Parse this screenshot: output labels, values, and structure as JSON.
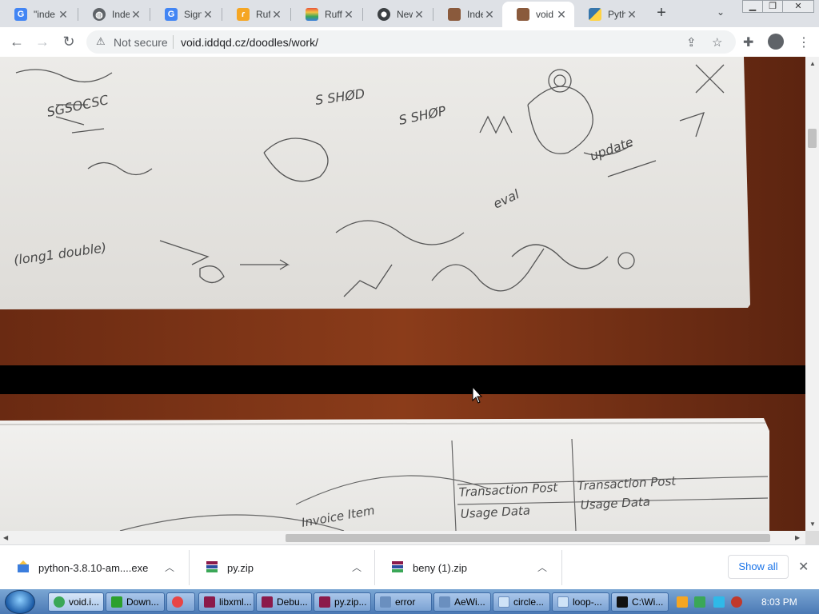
{
  "tabs": [
    {
      "title": "\"inde",
      "icon": "google-icon",
      "color": "#4285f4"
    },
    {
      "title": "Inde",
      "icon": "globe-icon",
      "color": "#5f6368"
    },
    {
      "title": "Sign",
      "icon": "google-icon",
      "color": "#4285f4"
    },
    {
      "title": "Ruffl",
      "icon": "ruffle-icon",
      "color": "#f5a623"
    },
    {
      "title": "Ruffl",
      "icon": "rainbow-icon",
      "color": "#e8543a"
    },
    {
      "title": "New",
      "icon": "chrome-icon",
      "color": "#3c4043"
    },
    {
      "title": "Inde",
      "icon": "portrait-icon",
      "color": "#8a5a3c"
    },
    {
      "title": "void",
      "icon": "portrait-icon",
      "color": "#8a5a3c",
      "active": true
    },
    {
      "title": "Pyth",
      "icon": "python-icon",
      "color": "#3776ab"
    }
  ],
  "toolbar": {
    "security_label": "Not secure",
    "url": "void.iddqd.cz/doodles/work/"
  },
  "downloads": {
    "items": [
      {
        "name": "python-3.8.10-am....exe",
        "icon": "installer-icon"
      },
      {
        "name": "py.zip",
        "icon": "winrar-archive-icon"
      },
      {
        "name": "beny (1).zip",
        "icon": "winrar-archive-icon"
      }
    ],
    "show_all_label": "Show all"
  },
  "taskbar": {
    "items": [
      {
        "label": "void.i...",
        "icon": "chrome-icon",
        "color": "#3aa757",
        "active": true
      },
      {
        "label": "Down...",
        "icon": "download-icon",
        "color": "#2ca02c"
      },
      {
        "label": "",
        "icon": "media-player-icon",
        "color": "#e84545"
      },
      {
        "label": "libxml...",
        "icon": "winrar-icon",
        "color": "#8b1a4a"
      },
      {
        "label": "Debu...",
        "icon": "winrar-icon",
        "color": "#8b1a4a"
      },
      {
        "label": "py.zip...",
        "icon": "winrar-icon",
        "color": "#8b1a4a"
      },
      {
        "label": "error",
        "icon": "window-icon",
        "color": "#6a8fbf"
      },
      {
        "label": "AeWi...",
        "icon": "window-icon",
        "color": "#6a8fbf"
      },
      {
        "label": "circle...",
        "icon": "notepad-icon",
        "color": "#cfe3f7"
      },
      {
        "label": "loop-...",
        "icon": "notepad-icon",
        "color": "#cfe3f7"
      },
      {
        "label": "C:\\Wi...",
        "icon": "cmd-icon",
        "color": "#111111"
      }
    ],
    "clock": "8:03 PM"
  }
}
